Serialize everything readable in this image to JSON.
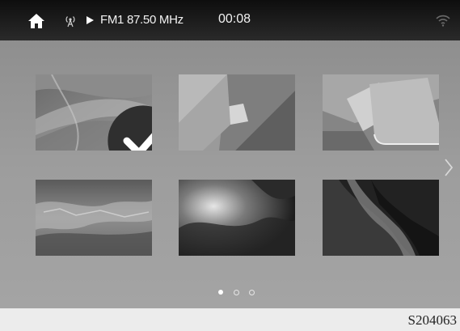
{
  "status_bar": {
    "source": "FM1",
    "frequency": "87.50 MHz",
    "station_display": "FM1 87.50 MHz",
    "time": "00:08",
    "icons": [
      "home-icon",
      "radio-antenna-icon",
      "play-icon",
      "wifi-icon"
    ]
  },
  "wallpapers": {
    "selected_index": 0,
    "items": [
      {
        "name": "wallpaper-1",
        "selected": true
      },
      {
        "name": "wallpaper-2",
        "selected": false
      },
      {
        "name": "wallpaper-3",
        "selected": false
      },
      {
        "name": "wallpaper-4",
        "selected": false
      },
      {
        "name": "wallpaper-5",
        "selected": false
      },
      {
        "name": "wallpaper-6",
        "selected": false
      }
    ]
  },
  "pagination": {
    "current_page": 1,
    "total_pages": 3
  },
  "footer": {
    "code": "S204063"
  },
  "colors": {
    "status_bar": "#1a1a1a",
    "background": "#969696",
    "footer": "#ececec"
  }
}
